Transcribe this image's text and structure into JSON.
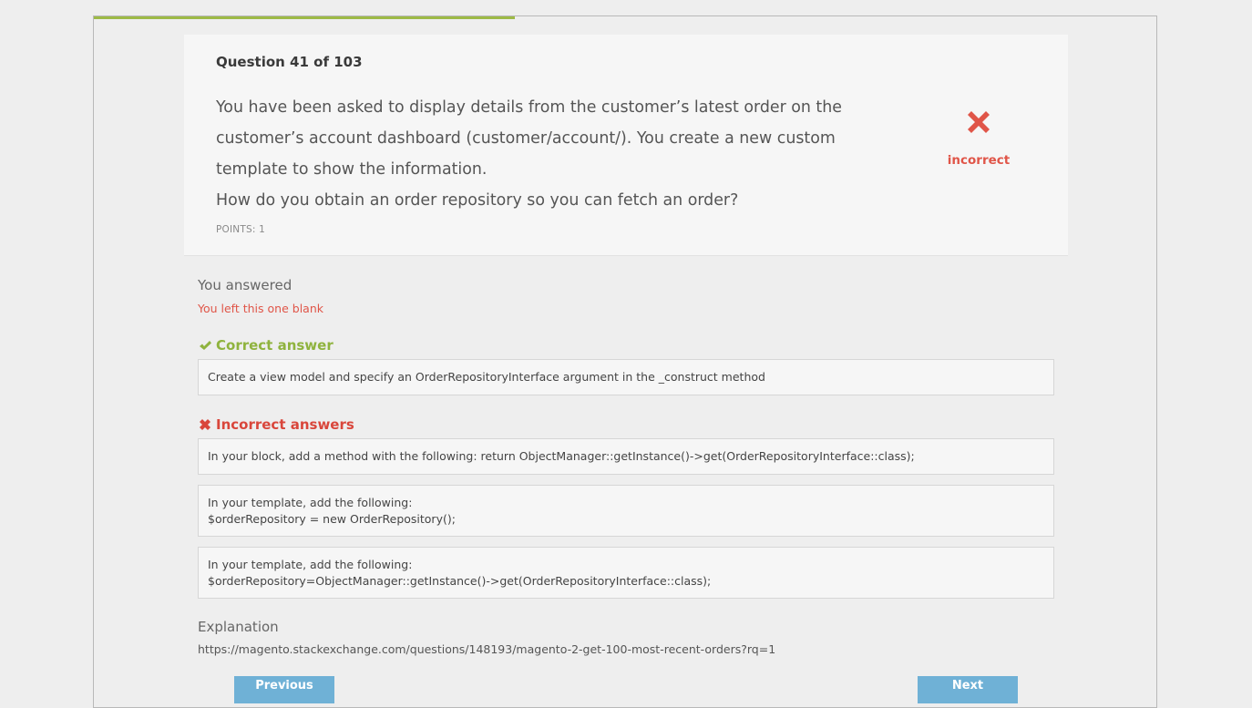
{
  "progress": {
    "fraction": 0.396
  },
  "question": {
    "number_label": "Question 41 of 103",
    "text_lines": [
      "You have been asked to display details from the customer’s latest order on the customer’s account dashboard (customer/account/). You create a new custom template to show the information.",
      "How do you obtain an order repository so you can fetch an order?"
    ],
    "points_label": "POINTS: 1",
    "status": {
      "icon": "red-x-icon",
      "label": "incorrect",
      "color": "#e05548"
    }
  },
  "result": {
    "you_answered_label": "You answered",
    "blank_message": "You left this one blank",
    "correct_heading": "Correct answer",
    "correct_answer": "Create a view model and specify an OrderRepositoryInterface argument in the _construct method",
    "incorrect_heading": "Incorrect answers",
    "incorrect_answers": [
      [
        "In your block, add a method with the following: return ObjectManager::getInstance()->get(OrderRepositoryInterface::class);"
      ],
      [
        "In your template, add the following:",
        "$orderRepository = new OrderRepository();"
      ],
      [
        "In your template, add the following:",
        "$orderRepository=ObjectManager::getInstance()->get(OrderRepositoryInterface::class);"
      ]
    ]
  },
  "explanation": {
    "heading": "Explanation",
    "link_text": "https://magento.stackexchange.com/questions/148193/magento-2-get-100-most-recent-orders?rq=1"
  },
  "nav": {
    "prev_label": "Previous",
    "next_label": "Next"
  },
  "colors": {
    "accent_green": "#9dba46",
    "correct_green": "#8fb33e",
    "incorrect_red": "#d9463b",
    "button_blue": "#6fb1d6"
  }
}
